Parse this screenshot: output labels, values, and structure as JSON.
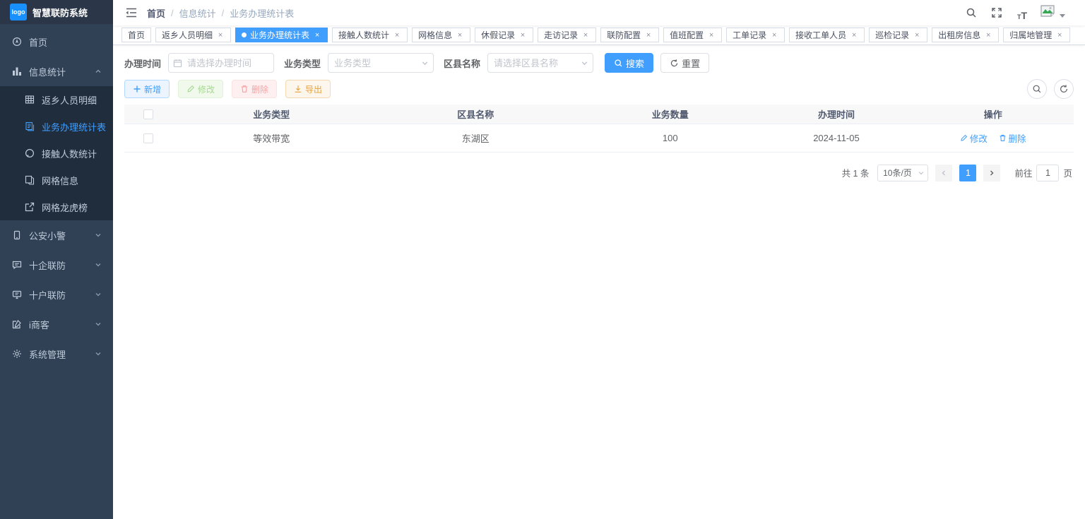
{
  "app": {
    "logo": "logo",
    "title": "智慧联防系统"
  },
  "sidebar": {
    "items": [
      {
        "label": "首页",
        "icon": "home-icon"
      },
      {
        "label": "信息统计",
        "icon": "bar-chart-icon",
        "expanded": true
      },
      {
        "label": "返乡人员明细",
        "icon": "table-icon"
      },
      {
        "label": "业务办理统计表",
        "icon": "document-icon",
        "active": true
      },
      {
        "label": "接触人数统计",
        "icon": "circle-icon"
      },
      {
        "label": "网格信息",
        "icon": "copy-icon"
      },
      {
        "label": "网格龙虎榜",
        "icon": "external-link-icon"
      },
      {
        "label": "公安小警",
        "icon": "phone-icon"
      },
      {
        "label": "十企联防",
        "icon": "message-icon"
      },
      {
        "label": "十户联防",
        "icon": "monitor-icon"
      },
      {
        "label": "i商客",
        "icon": "edit-icon"
      },
      {
        "label": "系统管理",
        "icon": "gear-icon"
      }
    ]
  },
  "breadcrumb": {
    "items": [
      "首页",
      "信息统计",
      "业务办理统计表"
    ]
  },
  "tabs": [
    {
      "label": "首页",
      "closable": false,
      "active": false
    },
    {
      "label": "返乡人员明细",
      "closable": true,
      "active": false
    },
    {
      "label": "业务办理统计表",
      "closable": true,
      "active": true
    },
    {
      "label": "接触人数统计",
      "closable": true,
      "active": false
    },
    {
      "label": "网格信息",
      "closable": true,
      "active": false
    },
    {
      "label": "休假记录",
      "closable": true,
      "active": false
    },
    {
      "label": "走访记录",
      "closable": true,
      "active": false
    },
    {
      "label": "联防配置",
      "closable": true,
      "active": false
    },
    {
      "label": "值班配置",
      "closable": true,
      "active": false
    },
    {
      "label": "工单记录",
      "closable": true,
      "active": false
    },
    {
      "label": "接收工单人员",
      "closable": true,
      "active": false
    },
    {
      "label": "巡检记录",
      "closable": true,
      "active": false
    },
    {
      "label": "出租房信息",
      "closable": true,
      "active": false
    },
    {
      "label": "归属地管理",
      "closable": true,
      "active": false
    }
  ],
  "filters": {
    "time_label": "办理时间",
    "time_placeholder": "请选择办理时间",
    "type_label": "业务类型",
    "type_placeholder": "业务类型",
    "district_label": "区县名称",
    "district_placeholder": "请选择区县名称",
    "search_label": "搜索",
    "reset_label": "重置"
  },
  "toolbar": {
    "add": "新增",
    "edit": "修改",
    "delete": "删除",
    "export": "导出"
  },
  "table": {
    "columns": [
      "业务类型",
      "区县名称",
      "业务数量",
      "办理时间",
      "操作"
    ],
    "rows": [
      {
        "business_type": "等效带宽",
        "district": "东湖区",
        "count": "100",
        "date": "2024-11-05"
      }
    ],
    "row_actions": {
      "edit": "修改",
      "delete": "删除"
    }
  },
  "pagination": {
    "total": "共 1 条",
    "page_size": "10条/页",
    "page": "1",
    "goto_label": "前往",
    "goto_value": "1",
    "unit_label": "页"
  },
  "icons": {
    "navbar": [
      "search-icon",
      "fullscreen-icon",
      "font-size-icon",
      "broken-avatar-icon",
      "caret-down-icon"
    ],
    "toolbar_right": [
      "search-toggle-icon",
      "refresh-icon"
    ]
  },
  "colors": {
    "primary": "#409eff",
    "sidebar_bg": "#304156",
    "submenu_bg": "#1f2d3d",
    "sidebar_text": "#bfcbd9",
    "table_header_bg": "#f8f8f9",
    "success": "#67c23a",
    "danger": "#f56c6c",
    "warning": "#e6a23c"
  }
}
